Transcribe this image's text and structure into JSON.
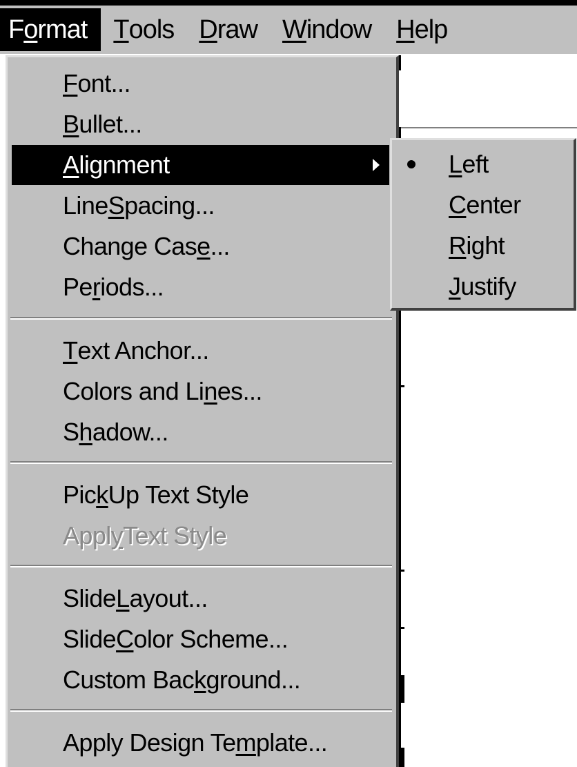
{
  "menubar": {
    "items": [
      {
        "pre": "F",
        "ul": "o",
        "post": "rmat"
      },
      {
        "pre": "",
        "ul": "T",
        "post": "ools"
      },
      {
        "pre": "",
        "ul": "D",
        "post": "raw"
      },
      {
        "pre": "",
        "ul": "W",
        "post": "indow"
      },
      {
        "pre": "",
        "ul": "H",
        "post": "elp"
      }
    ]
  },
  "format_menu": {
    "items": [
      {
        "pre": "",
        "ul": "F",
        "post": "ont..."
      },
      {
        "pre": "",
        "ul": "B",
        "post": "ullet..."
      },
      {
        "pre": "",
        "ul": "A",
        "post": "lignment"
      },
      {
        "pre": "Line ",
        "ul": "S",
        "post": "pacing..."
      },
      {
        "pre": "Change Cas",
        "ul": "e",
        "post": "..."
      },
      {
        "pre": "Pe",
        "ul": "r",
        "post": "iods..."
      },
      {
        "pre": "",
        "ul": "T",
        "post": "ext Anchor..."
      },
      {
        "pre": "Colors and Li",
        "ul": "n",
        "post": "es..."
      },
      {
        "pre": "S",
        "ul": "h",
        "post": "adow..."
      },
      {
        "pre": "Pic",
        "ul": "k",
        "post": " Up Text Style"
      },
      {
        "pre": "Appl",
        "ul": "y",
        "post": " Text Style"
      },
      {
        "pre": "Slide ",
        "ul": "L",
        "post": "ayout..."
      },
      {
        "pre": "Slide ",
        "ul": "C",
        "post": "olor Scheme..."
      },
      {
        "pre": "Custom Bac",
        "ul": "k",
        "post": "ground..."
      },
      {
        "pre": "Apply Design Te",
        "ul": "m",
        "post": "plate..."
      }
    ]
  },
  "alignment_submenu": {
    "items": [
      {
        "pre": "",
        "ul": "L",
        "post": "eft"
      },
      {
        "pre": "",
        "ul": "C",
        "post": "enter"
      },
      {
        "pre": "",
        "ul": "R",
        "post": "ight"
      },
      {
        "pre": "",
        "ul": "J",
        "post": "ustify"
      }
    ]
  }
}
